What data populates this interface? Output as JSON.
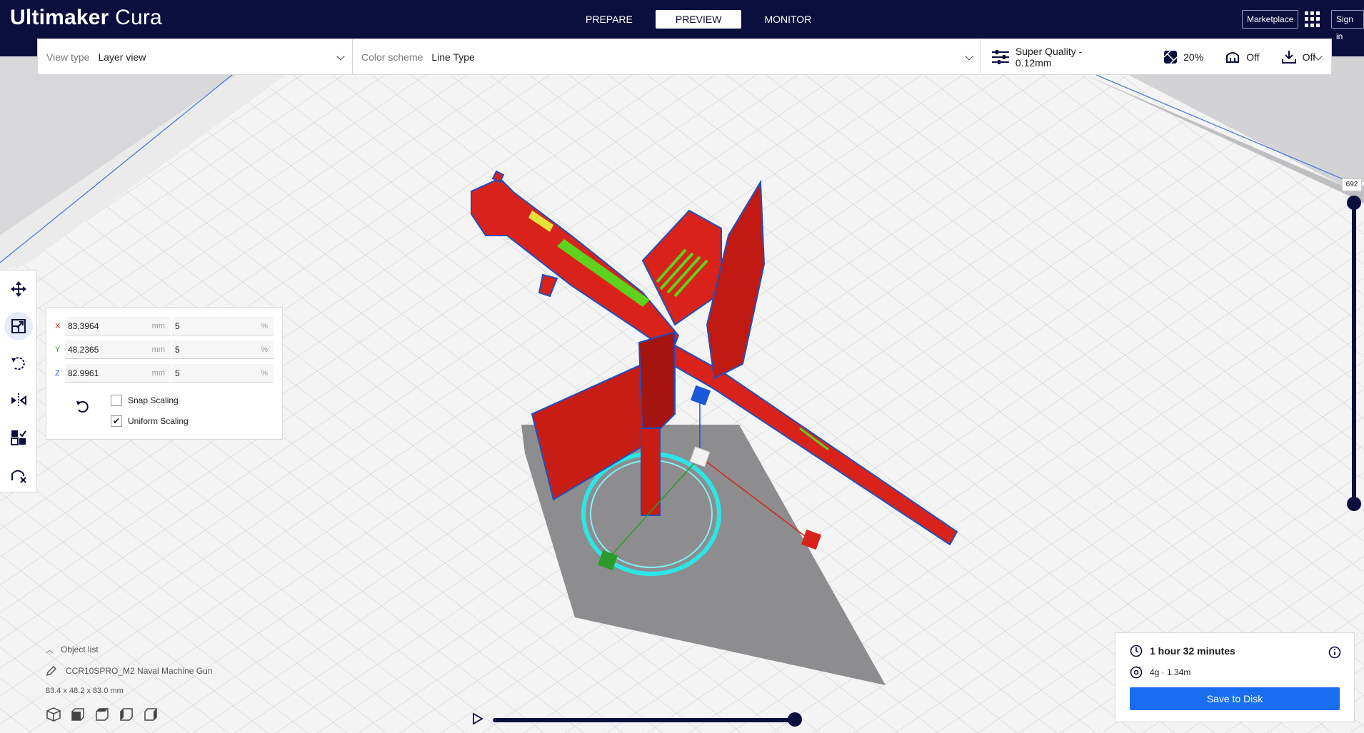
{
  "app": {
    "brand_bold": "Ultimaker",
    "brand_light": "Cura"
  },
  "stages": [
    {
      "label": "PREPARE"
    },
    {
      "label": "PREVIEW"
    },
    {
      "label": "MONITOR"
    }
  ],
  "header": {
    "marketplace": "Marketplace",
    "sign_in": "Sign in"
  },
  "view": {
    "view_type_label": "View type",
    "view_type_value": "Layer view",
    "color_scheme_label": "Color scheme",
    "color_scheme_value": "Line Type"
  },
  "print_setup": {
    "profile": "Super Quality - 0.12mm",
    "infill": "20%",
    "support": "Off",
    "adhesion": "Off"
  },
  "scale": {
    "x": {
      "axis": "X",
      "value": "83.3964",
      "unit": "mm",
      "percent": "5",
      "pct_unit": "%"
    },
    "y": {
      "axis": "Y",
      "value": "48.2365",
      "unit": "mm",
      "percent": "5",
      "pct_unit": "%"
    },
    "z": {
      "axis": "Z",
      "value": "82.9961",
      "unit": "mm",
      "percent": "5",
      "pct_unit": "%"
    },
    "snap_scaling": "Snap Scaling",
    "uniform_scaling": "Uniform Scaling"
  },
  "layer": {
    "current": "692"
  },
  "object_list": {
    "title": "Object list",
    "item": "CCR10SPRO_M2 Naval Machine Gun",
    "dimensions": "83.4 x 48.2 x 83.0 mm"
  },
  "summary": {
    "time": "1 hour 32 minutes",
    "material": "4g · 1.34m",
    "save": "Save to Disk"
  },
  "colors": {
    "header_bg": "#0b0f3d",
    "accent": "#196ef0",
    "model_red": "#d8221a",
    "model_green": "#5fd21e",
    "skirt_cyan": "#2ce6e6"
  }
}
